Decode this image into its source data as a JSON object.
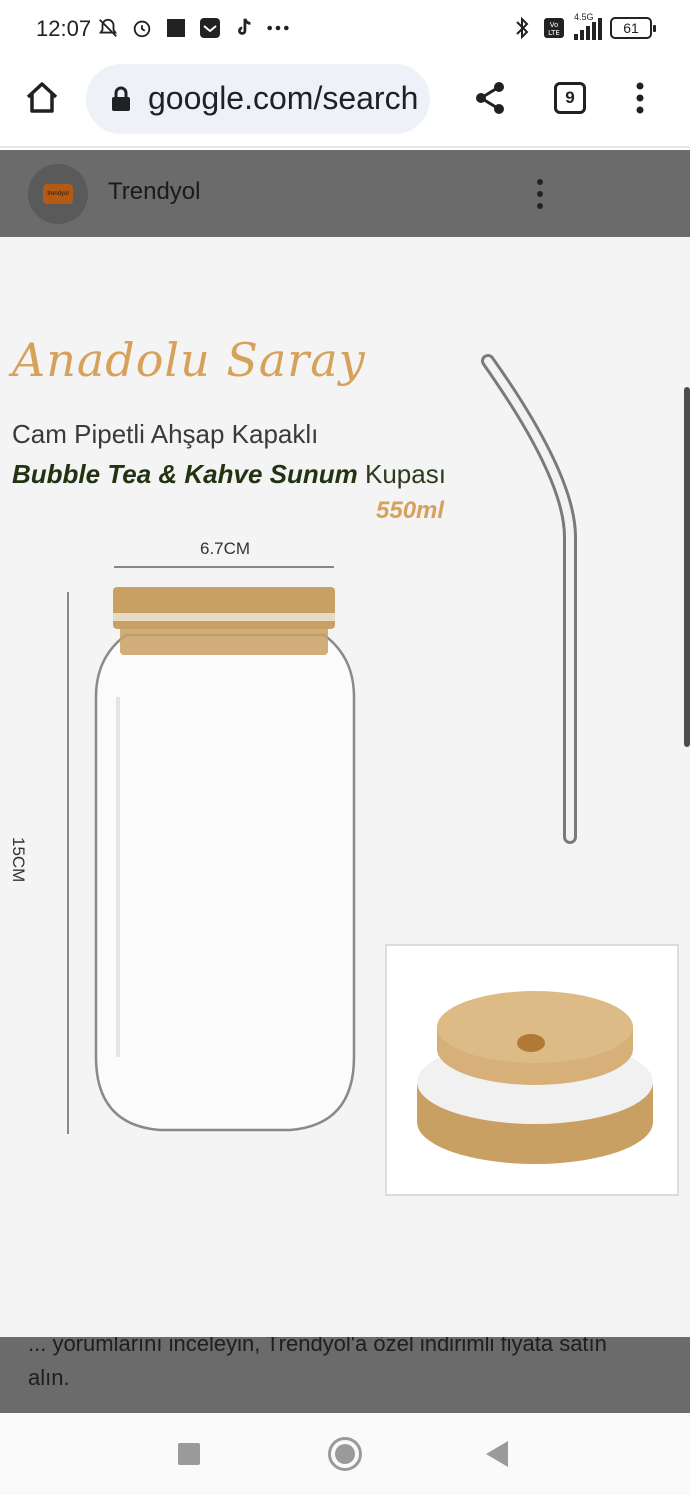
{
  "status_bar": {
    "time": "12:07",
    "left_icons": [
      "bell-off-icon",
      "alarm-icon",
      "square-icon",
      "mail-icon",
      "tiktok-icon",
      "more-dots-icon"
    ],
    "network": "4.5G",
    "battery": "61"
  },
  "browser": {
    "url": "google.com/search",
    "tab_count": "9"
  },
  "result": {
    "site_name": "Trendyol",
    "logo_text": "trendyol",
    "product_image": {
      "brand": "Anadolu Saray",
      "line1": "Cam Pipetli Ahşap Kapaklı",
      "line2_bold": "Bubble Tea & Kahve Sunum",
      "line2_rest": " Kupası",
      "volume": "550ml",
      "width_label": "6.7CM",
      "height_label": "15CM"
    },
    "snippet": "... yorumlarını inceleyin, Trendyol'a özel indirimli fiyata satın alın."
  },
  "colors": {
    "gold": "#d6a15a",
    "scrim": "#6b6b6b",
    "url_bar": "#eef1f7",
    "wood": "#c9a063"
  }
}
